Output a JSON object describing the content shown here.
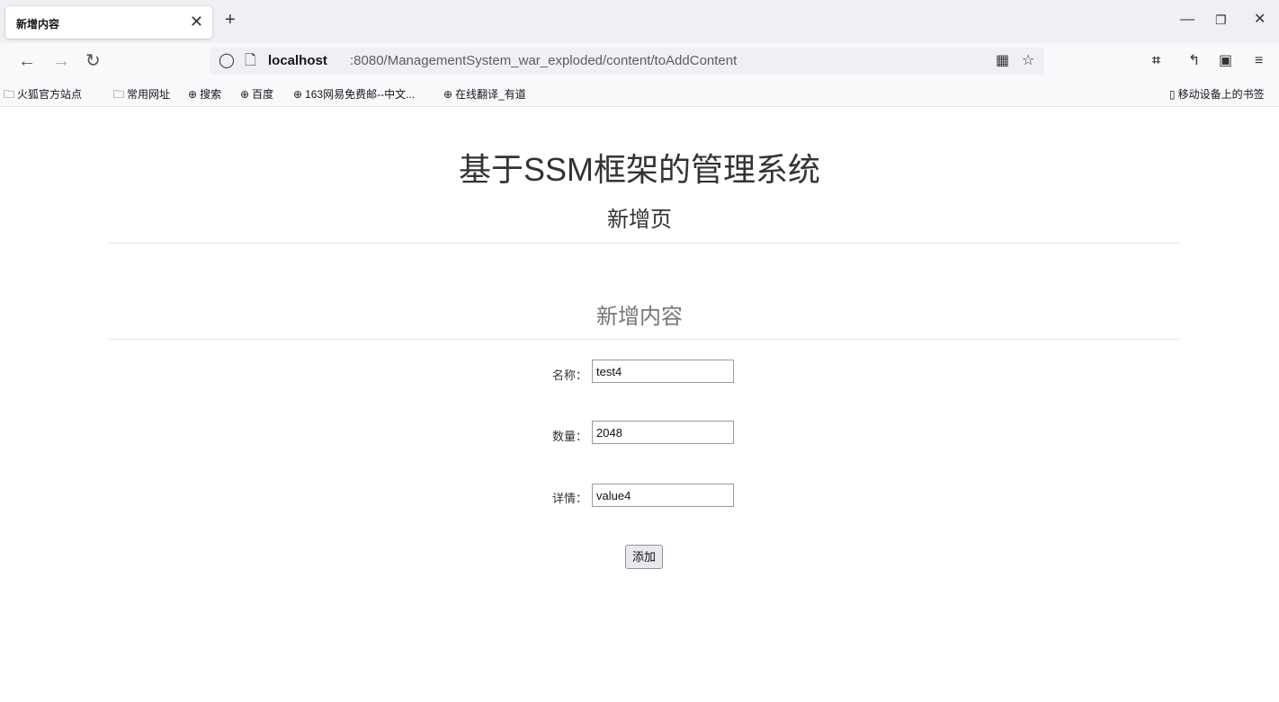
{
  "tab": {
    "title": "新增内容"
  },
  "address_bar": {
    "host": "localhost",
    "rest": ":8080/ManagementSystem_war_exploded/content/toAddContent"
  },
  "bookmarks": [
    {
      "icon": "folder-icon",
      "label": "火狐官方站点"
    },
    {
      "icon": "folder-icon",
      "label": "常用网址"
    },
    {
      "icon": "globe-icon",
      "label": "搜索"
    },
    {
      "icon": "globe-icon",
      "label": "百度"
    },
    {
      "icon": "globe-icon",
      "label": "163网易免费邮--中文..."
    },
    {
      "icon": "globe-icon",
      "label": "在线翻译_有道"
    }
  ],
  "mobile_bookmarks": "移动设备上的书签",
  "page": {
    "title": "基于SSM框架的管理系统",
    "subtitle": "新增页",
    "form_title": "新增内容"
  },
  "form": {
    "fields": [
      {
        "label": "名称：",
        "value": "test4"
      },
      {
        "label": "数量：",
        "value": "2048"
      },
      {
        "label": "详情：",
        "value": "value4"
      }
    ],
    "submit_label": "添加"
  }
}
